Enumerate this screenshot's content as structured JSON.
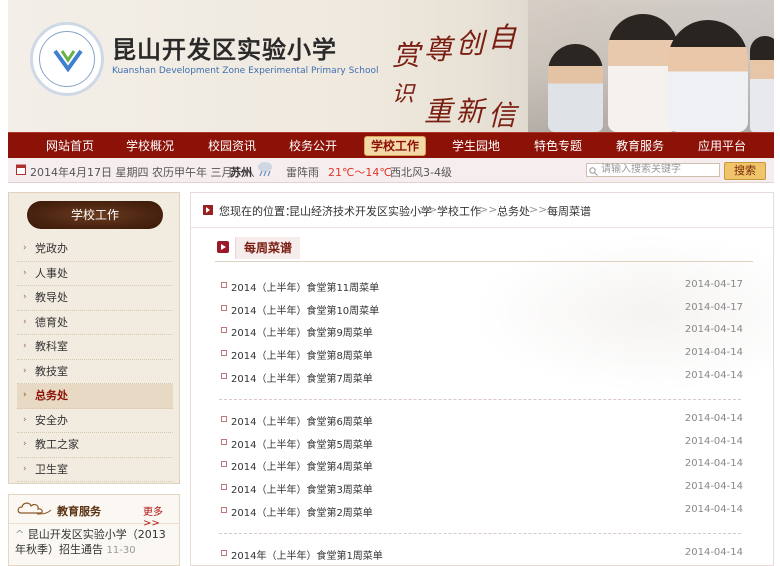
{
  "header": {
    "school_name_cn": "昆山开发区实验小学",
    "school_name_en": "Kuanshan Development Zone Experimental Primary School",
    "motto_chars": [
      "赏",
      "尊",
      "创",
      "自",
      "识",
      "重",
      "新",
      "信"
    ]
  },
  "nav": {
    "items": [
      {
        "label": "网站首页",
        "active": false
      },
      {
        "label": "学校概况",
        "active": false
      },
      {
        "label": "校园资讯",
        "active": false
      },
      {
        "label": "校务公开",
        "active": false
      },
      {
        "label": "学校工作",
        "active": true
      },
      {
        "label": "学生园地",
        "active": false
      },
      {
        "label": "特色专题",
        "active": false
      },
      {
        "label": "教育服务",
        "active": false
      },
      {
        "label": "应用平台",
        "active": false
      }
    ]
  },
  "infobar": {
    "date": "2014年4月17日 星期四 农历甲午年 三月十八",
    "city": "苏州",
    "weather": "雷阵雨",
    "temp": "21℃～14℃",
    "wind": "西北风3-4级",
    "search_placeholder": "请输入搜索关键字",
    "search_button": "搜索"
  },
  "sidebar": {
    "title": "学校工作",
    "items": [
      {
        "label": "党政办",
        "active": false
      },
      {
        "label": "人事处",
        "active": false
      },
      {
        "label": "教导处",
        "active": false
      },
      {
        "label": "德育处",
        "active": false
      },
      {
        "label": "教科室",
        "active": false
      },
      {
        "label": "教技室",
        "active": false
      },
      {
        "label": "总务处",
        "active": true
      },
      {
        "label": "安全办",
        "active": false
      },
      {
        "label": "教工之家",
        "active": false
      },
      {
        "label": "卫生室",
        "active": false
      }
    ]
  },
  "edu_service": {
    "title": "教育服务",
    "more": "更多>>",
    "item_text": "昆山开发区实验小学（2013年秋季）招生通告",
    "item_date": "11-30"
  },
  "breadcrumb": {
    "prefix": "您现在的位置：",
    "items": [
      "昆山经济技术开发区实验小学",
      "学校工作",
      "总务处",
      "每周菜谱"
    ],
    "sep": ">>"
  },
  "section": {
    "title": "每周菜谱"
  },
  "list_groups": [
    [
      {
        "title": "2014（上半年）食堂第11周菜单",
        "date": "2014-04-17"
      },
      {
        "title": "2014（上半年）食堂第10周菜单",
        "date": "2014-04-17"
      },
      {
        "title": "2014（上半年）食堂第9周菜单",
        "date": "2014-04-14"
      },
      {
        "title": "2014（上半年）食堂第8周菜单",
        "date": "2014-04-14"
      },
      {
        "title": "2014（上半年）食堂第7周菜单",
        "date": "2014-04-14"
      }
    ],
    [
      {
        "title": "2014（上半年）食堂第6周菜单",
        "date": "2014-04-14"
      },
      {
        "title": "2014（上半年）食堂第5周菜单",
        "date": "2014-04-14"
      },
      {
        "title": "2014（上半年）食堂第4周菜单",
        "date": "2014-04-14"
      },
      {
        "title": "2014（上半年）食堂第3周菜单",
        "date": "2014-04-14"
      },
      {
        "title": "2014（上半年）食堂第2周菜单",
        "date": "2014-04-14"
      }
    ],
    [
      {
        "title": "2014年（上半年）食堂第1周菜单",
        "date": "2014-04-14"
      }
    ]
  ],
  "colors": {
    "nav_bg": "#8c1208",
    "accent": "#7a1e12",
    "active_tab_bg": "#f4d9a8"
  }
}
